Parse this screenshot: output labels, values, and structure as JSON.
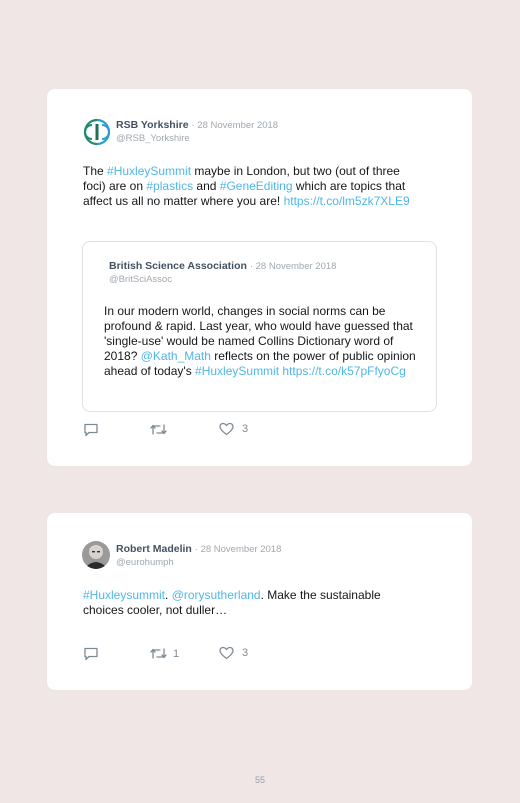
{
  "tweets": [
    {
      "name": "RSB Yorkshire",
      "date": "· 28 November 2018",
      "handle": "@RSB_Yorkshire",
      "text_parts": [
        {
          "t": "The ",
          "link": false
        },
        {
          "t": "#HuxleySummit",
          "link": true
        },
        {
          "t": " maybe in London, but two (out of three foci) are on ",
          "link": false
        },
        {
          "t": "#plastics",
          "link": true
        },
        {
          "t": " and ",
          "link": false
        },
        {
          "t": "#GeneEditing",
          "link": true
        },
        {
          "t": " which are topics that affect us all no matter where you are! ",
          "link": false
        },
        {
          "t": "https://t.co/lm5zk7XLE9",
          "link": true
        }
      ],
      "quote": {
        "name": "British Science Association",
        "date": "· 28 November 2018",
        "handle": "@BritSciAssoc",
        "text_parts": [
          {
            "t": "In our modern world, changes in social norms can be profound & rapid. Last year, who would have guessed that 'single-use' would be named Collins Dictionary word of 2018? ",
            "link": false
          },
          {
            "t": "@Kath_Math",
            "link": true
          },
          {
            "t": " reflects on the power of public opinion ahead of today's ",
            "link": false
          },
          {
            "t": "#HuxleySummit",
            "link": true
          },
          {
            "t": " ",
            "link": false
          },
          {
            "t": "https://t.co/k57pFfyoCg",
            "link": true
          }
        ]
      },
      "retweets": "",
      "likes": "3"
    },
    {
      "name": "Robert Madelin",
      "date": "· 28 November 2018",
      "handle": "@eurohumph",
      "text_parts": [
        {
          "t": "#Huxleysummit",
          "link": true
        },
        {
          "t": ". ",
          "link": false
        },
        {
          "t": "@rorysutherland",
          "link": true
        },
        {
          "t": ". Make the sustainable choices cooler, not duller…",
          "link": false
        }
      ],
      "retweets": "1",
      "likes": "3"
    }
  ],
  "page_number": "55",
  "colors": {
    "link": "#4fb7e6",
    "name": "#44525f",
    "background": "#f0e6e6"
  },
  "icons": [
    "rsb-logo-icon",
    "avatar-photo-icon",
    "reply-icon",
    "retweet-icon",
    "heart-icon"
  ]
}
